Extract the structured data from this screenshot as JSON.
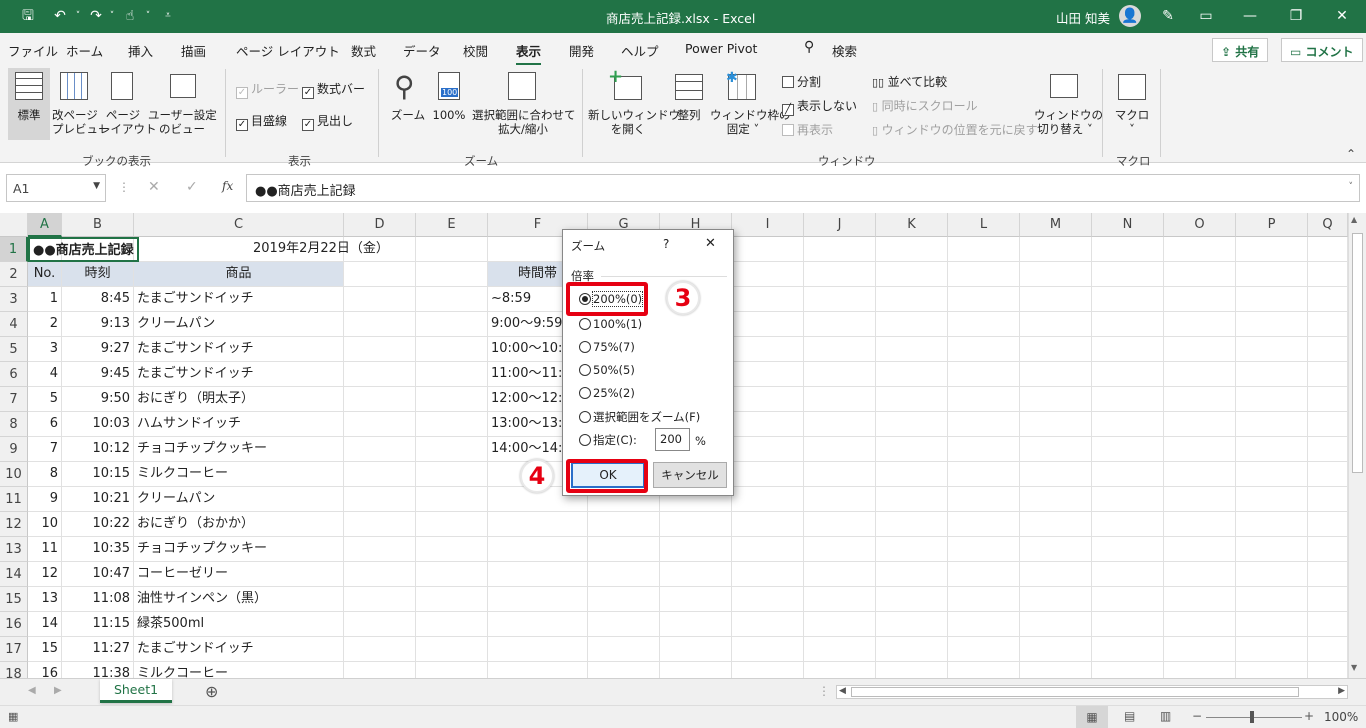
{
  "titlebar": {
    "title": "商店売上記録.xlsx  -  Excel",
    "user": "山田 知美",
    "bg_color": "#217346"
  },
  "tabs": [
    "ファイル",
    "ホーム",
    "挿入",
    "描画",
    "ページ レイアウト",
    "数式",
    "データ",
    "校閲",
    "表示",
    "開発",
    "ヘルプ",
    "Power Pivot",
    "検索"
  ],
  "active_tab": "表示",
  "header_buttons": {
    "share": "共有",
    "comment": "コメント"
  },
  "ribbon": {
    "book_view": {
      "group": "ブックの表示",
      "normal": "標準",
      "page_break_1": "改ページ",
      "page_break_2": "プレビュー",
      "page_layout_1": "ページ",
      "page_layout_2": "レイアウト",
      "custom_1": "ユーザー設定",
      "custom_2": "のビュー"
    },
    "show": {
      "group": "表示",
      "ruler": "ルーラー",
      "formula_bar": "数式バー",
      "gridlines": "目盛線",
      "headings": "見出し"
    },
    "zoom": {
      "group": "ズーム",
      "zoom": "ズーム",
      "hundred": "100%",
      "hundred_icon": "100",
      "sel_1": "選択範囲に合わせて",
      "sel_2": "拡大/縮小"
    },
    "window": {
      "group": "ウィンドウ",
      "new_1": "新しいウィンドウ",
      "new_2": "を開く",
      "arrange": "整列",
      "freeze_1": "ウィンドウ枠の",
      "freeze_2": "固定 ˅",
      "split": "分割",
      "hide": "表示しない",
      "unhide": "再表示",
      "side": "並べて比較",
      "sync": "同時にスクロール",
      "reset": "ウィンドウの位置を元に戻す",
      "switch_1": "ウィンドウの",
      "switch_2": "切り替え ˅"
    },
    "macro": {
      "group": "マクロ",
      "macro": "マクロ",
      "arrow": "˅"
    }
  },
  "formula_bar": {
    "name_box": "A1",
    "value": "●●商店売上記録",
    "fx": "fx"
  },
  "columns": [
    "A",
    "B",
    "C",
    "D",
    "E",
    "F",
    "G",
    "H",
    "I",
    "J",
    "K",
    "L",
    "M",
    "N",
    "O",
    "P",
    "Q"
  ],
  "rows": [
    {
      "n": "1",
      "a": "●●商店売上記録",
      "b": "",
      "c": "2019年2月22日（金）",
      "f": ""
    },
    {
      "n": "2",
      "a": "No.",
      "b": "時刻",
      "c": "商品",
      "f": "時間帯"
    },
    {
      "n": "3",
      "a": "1",
      "b": "8:45",
      "c": "たまごサンドイッチ",
      "f": "~8:59"
    },
    {
      "n": "4",
      "a": "2",
      "b": "9:13",
      "c": "クリームパン",
      "f": "9:00〜9:59"
    },
    {
      "n": "5",
      "a": "3",
      "b": "9:27",
      "c": "たまごサンドイッチ",
      "f": "10:00〜10:"
    },
    {
      "n": "6",
      "a": "4",
      "b": "9:45",
      "c": "たまごサンドイッチ",
      "f": "11:00〜11:"
    },
    {
      "n": "7",
      "a": "5",
      "b": "9:50",
      "c": "おにぎり（明太子）",
      "f": "12:00〜12:"
    },
    {
      "n": "8",
      "a": "6",
      "b": "10:03",
      "c": "ハムサンドイッチ",
      "f": "13:00〜13:"
    },
    {
      "n": "9",
      "a": "7",
      "b": "10:12",
      "c": "チョコチップクッキー",
      "f": "14:00〜14:"
    },
    {
      "n": "10",
      "a": "8",
      "b": "10:15",
      "c": "ミルクコーヒー",
      "f": ""
    },
    {
      "n": "11",
      "a": "9",
      "b": "10:21",
      "c": "クリームパン",
      "f": ""
    },
    {
      "n": "12",
      "a": "10",
      "b": "10:22",
      "c": "おにぎり（おかか）",
      "f": ""
    },
    {
      "n": "13",
      "a": "11",
      "b": "10:35",
      "c": "チョコチップクッキー",
      "f": ""
    },
    {
      "n": "14",
      "a": "12",
      "b": "10:47",
      "c": "コーヒーゼリー",
      "f": ""
    },
    {
      "n": "15",
      "a": "13",
      "b": "11:08",
      "c": "油性サインペン（黒）",
      "f": ""
    },
    {
      "n": "16",
      "a": "14",
      "b": "11:15",
      "c": "緑茶500ml",
      "f": ""
    },
    {
      "n": "17",
      "a": "15",
      "b": "11:27",
      "c": "たまごサンドイッチ",
      "f": ""
    },
    {
      "n": "18",
      "a": "16",
      "b": "11:38",
      "c": "ミルクコーヒー",
      "f": ""
    }
  ],
  "dialog": {
    "title": "ズーム",
    "help": "?",
    "close": "✕",
    "section": "倍率",
    "options": [
      "200%(0)",
      "100%(1)",
      "75%(7)",
      "50%(5)",
      "25%(2)",
      "選択範囲をズーム(F)",
      "指定(C):"
    ],
    "selected": "200%(0)",
    "custom_value": "200",
    "percent": "%",
    "ok": "OK",
    "cancel": "キャンセル"
  },
  "callouts": {
    "step3": "3",
    "step4": "4",
    "color": "#e60012"
  },
  "sheet_tab": "Sheet1",
  "add_sheet": "⊕",
  "status": {
    "zoom": "100%",
    "minus": "−",
    "plus": "+"
  }
}
